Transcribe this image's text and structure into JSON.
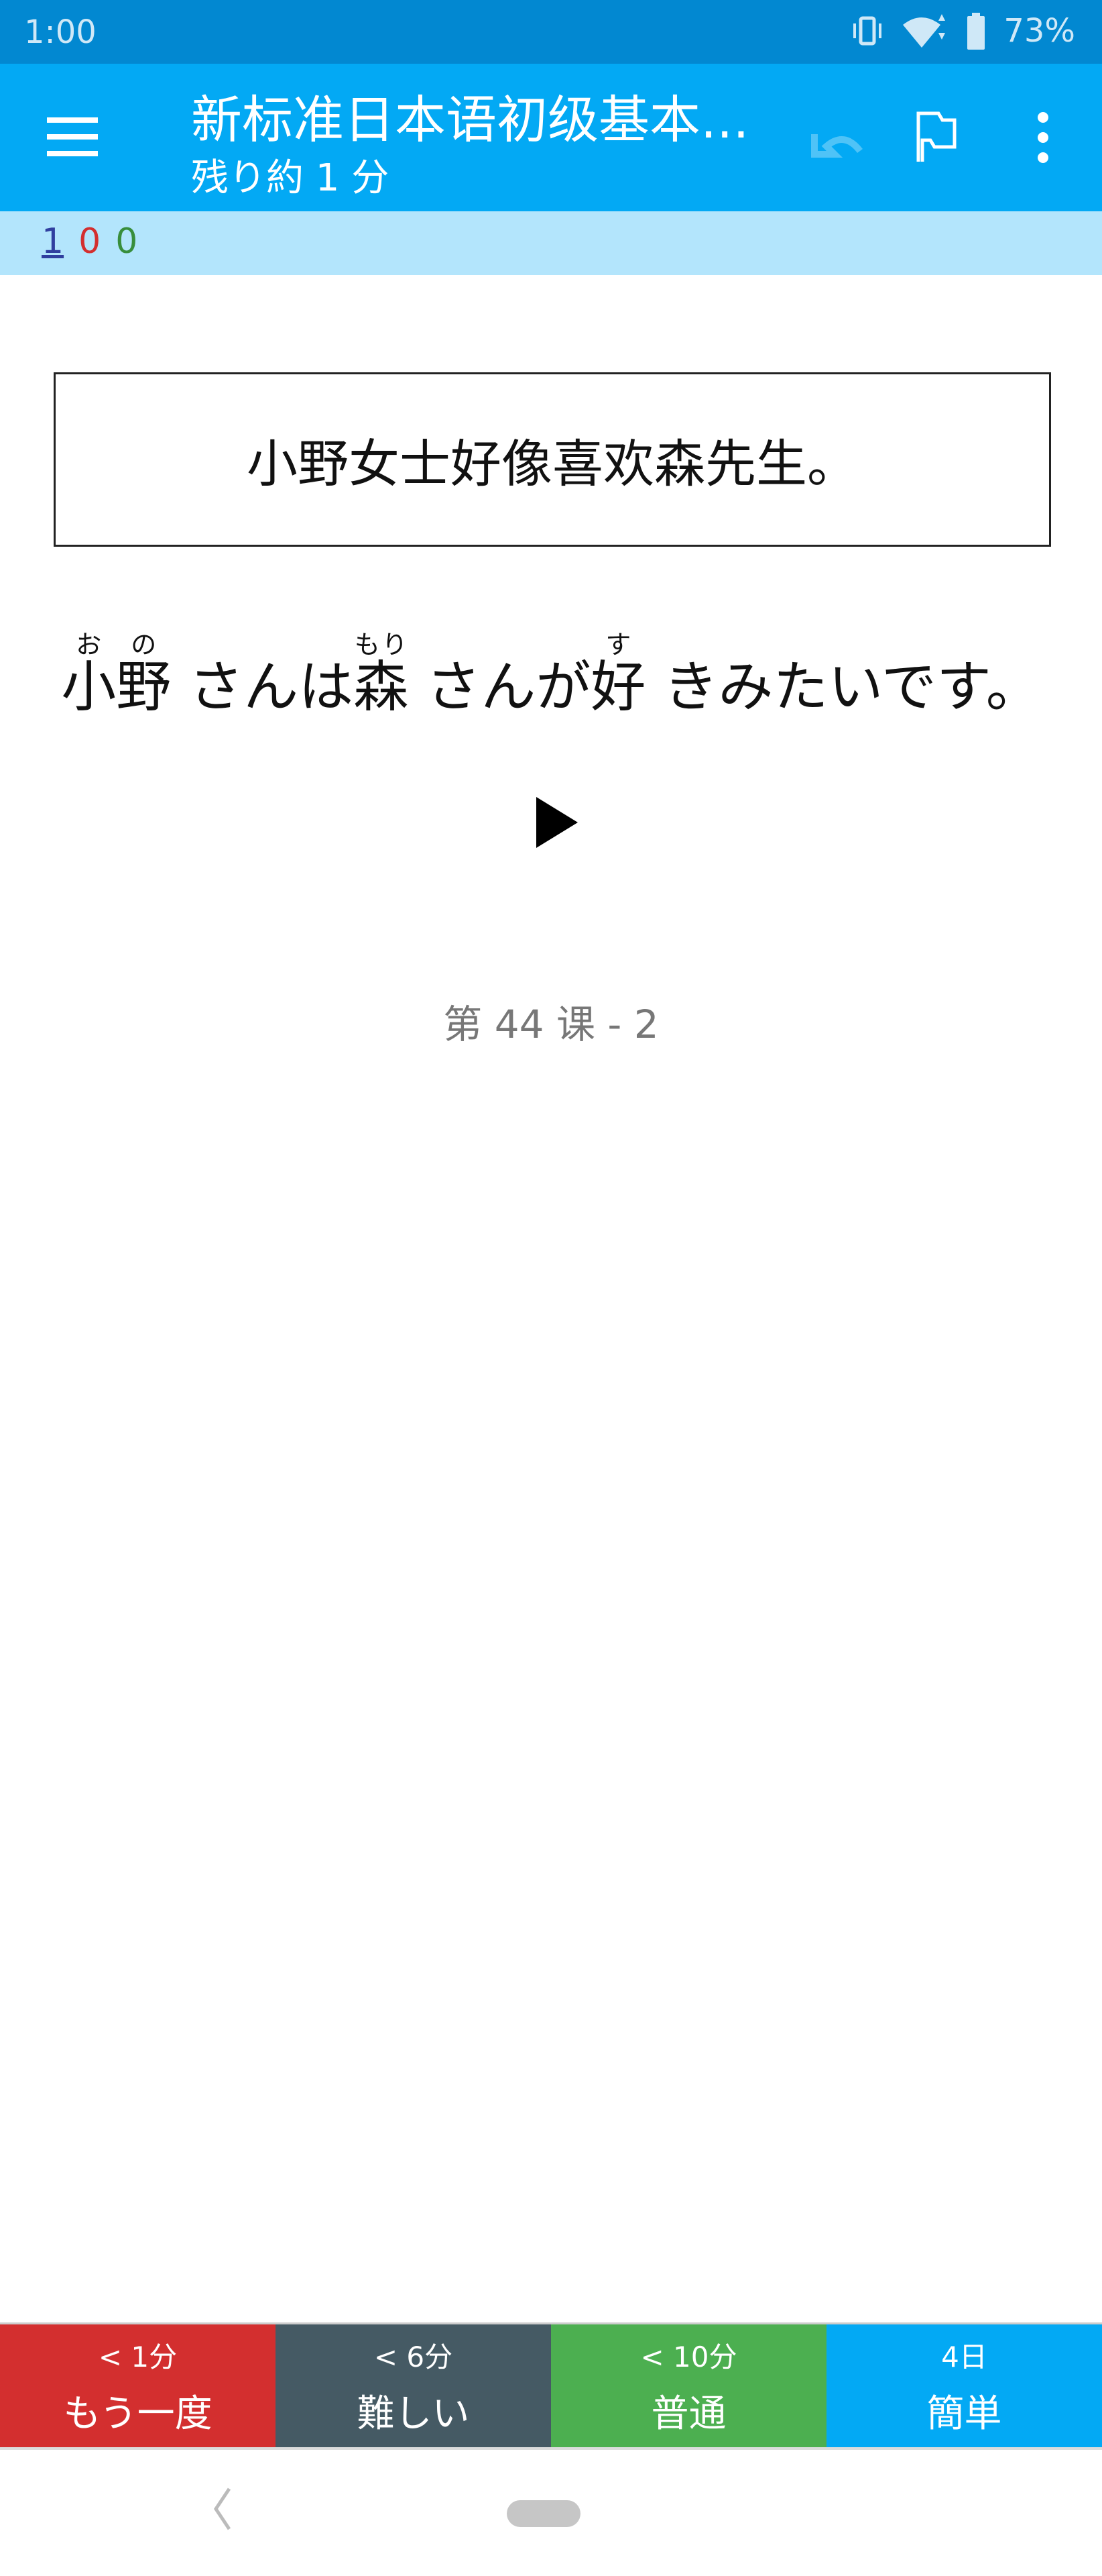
{
  "status_bar": {
    "time": "1:00",
    "battery": "73%",
    "icons": [
      "vibrate-icon",
      "wifi-icon",
      "battery-icon"
    ]
  },
  "app_bar": {
    "title": "新标准日本语初级基本...",
    "subtitle": "残り約 1 分",
    "icons": [
      "menu-icon",
      "undo-icon",
      "flag-icon",
      "more-vert-icon"
    ]
  },
  "counts": {
    "new": "1",
    "learning": "0",
    "review": "0",
    "colors": {
      "new": "#303f9f",
      "learning": "#d32f2f",
      "review": "#388e3c"
    }
  },
  "card": {
    "question": "小野女士好像喜欢森先生。",
    "answer_segments": [
      {
        "base": "小野",
        "ruby": "おの"
      },
      {
        "text": " さんは"
      },
      {
        "base": "森",
        "ruby": "もり"
      },
      {
        "text": " さんが"
      },
      {
        "base": "好",
        "ruby": "す"
      },
      {
        "text": " きみたいです。"
      }
    ],
    "lesson": "第 44 课 - 2"
  },
  "answer_buttons": [
    {
      "time": "< 1分",
      "label": "もう一度",
      "color": "#d32f2f"
    },
    {
      "time": "< 6分",
      "label": "難しい",
      "color": "#455a64"
    },
    {
      "time": "< 10分",
      "label": "普通",
      "color": "#4caf50"
    },
    {
      "time": "4日",
      "label": "簡単",
      "color": "#03a9f4"
    }
  ]
}
